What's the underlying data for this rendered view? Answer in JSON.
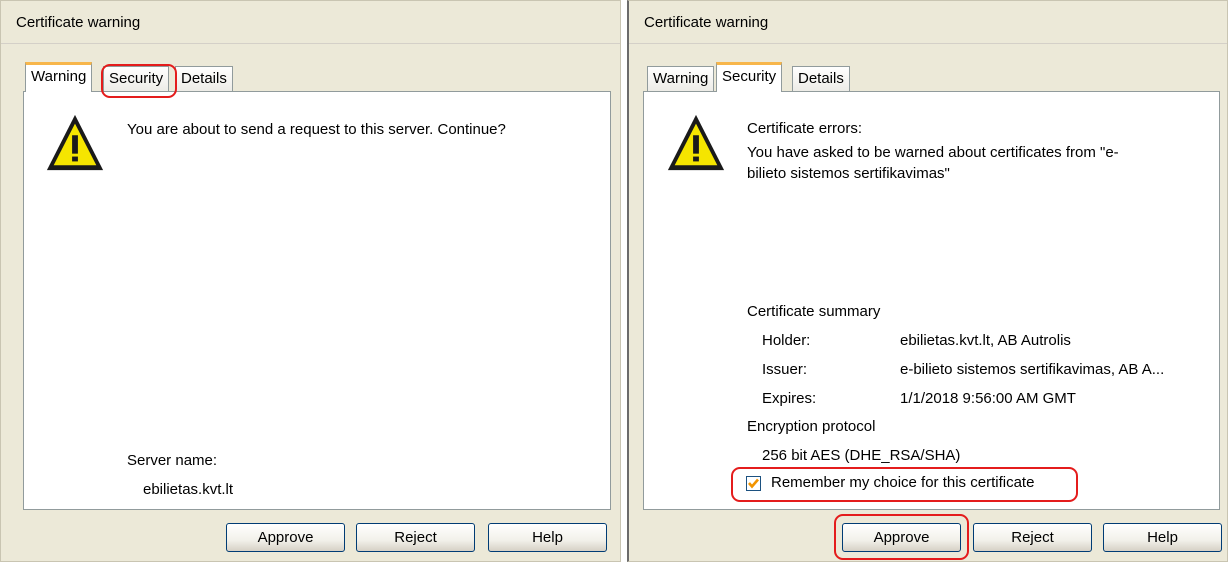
{
  "left": {
    "title": "Certificate warning",
    "tabs": [
      "Warning",
      "Security",
      "Details"
    ],
    "message": "You are about to send a request to this server. Continue?",
    "server_name_label": "Server name:",
    "server_name_value": "ebilietas.kvt.lt",
    "buttons": {
      "approve": "Approve",
      "reject": "Reject",
      "help": "Help"
    }
  },
  "right": {
    "title": "Certificate warning",
    "tabs": [
      "Warning",
      "Security",
      "Details"
    ],
    "errors_heading": "Certificate errors:",
    "errors_line1": "You have asked to be warned about certificates from \"e-",
    "errors_line2": "bilieto sistemos sertifikavimas\"",
    "summary_heading": "Certificate summary",
    "holder_label": "Holder:",
    "holder_value": "ebilietas.kvt.lt, AB Autrolis",
    "issuer_label": "Issuer:",
    "issuer_value": "e-bilieto sistemos sertifikavimas, AB A...",
    "expires_label": "Expires:",
    "expires_value": "1/1/2018 9:56:00 AM GMT",
    "encryption_heading": "Encryption protocol",
    "encryption_value": "256 bit AES (DHE_RSA/SHA)",
    "remember_label": "Remember my choice for this certificate",
    "remember_checked": true,
    "buttons": {
      "approve": "Approve",
      "reject": "Reject",
      "help": "Help"
    }
  },
  "icons": {
    "warning": "warning-triangle-icon",
    "checkmark": "checkmark-icon"
  },
  "colors": {
    "highlight": "#e41c1c",
    "tab_active_accent": "#f7b64b",
    "window_bg": "#ece9d8",
    "warning_yellow": "#f5e500"
  }
}
